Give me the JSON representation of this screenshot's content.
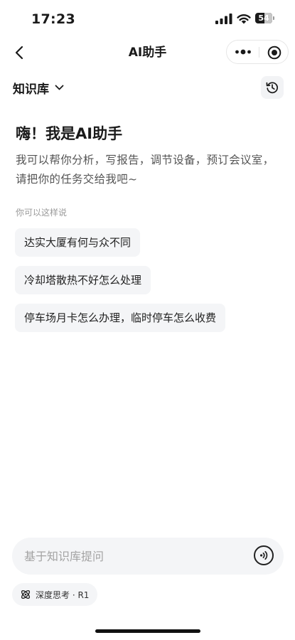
{
  "status_bar": {
    "time": "17:23",
    "battery": "54",
    "battery_level": 0.54
  },
  "nav": {
    "title": "AI助手"
  },
  "knowledge": {
    "label": "知识库"
  },
  "greeting": {
    "title": "嗨！我是AI助手",
    "intro": "我可以帮你分析，写报告，调节设备，预订会议室，请把你的任务交给我吧~"
  },
  "suggestions": {
    "hint": "你可以这样说",
    "items": [
      {
        "text": "达实大厦有何与众不同"
      },
      {
        "text": "冷却塔散热不好怎么处理"
      },
      {
        "text": "停车场月卡怎么办理，临时停车怎么收费"
      }
    ]
  },
  "input": {
    "placeholder": "基于知识库提问",
    "value": ""
  },
  "deep_think": {
    "label": "深度思考 · R1"
  },
  "colors": {
    "background": "#ffffff",
    "chip": "#f4f5f7",
    "text": "#1a1a1a",
    "muted": "#555555"
  },
  "icons": [
    "back-arrow-icon",
    "more-icon",
    "close-target-icon",
    "chevron-down-icon",
    "history-icon",
    "voice-icon",
    "deep-think-icon",
    "signal-icon",
    "wifi-icon",
    "battery-icon"
  ]
}
